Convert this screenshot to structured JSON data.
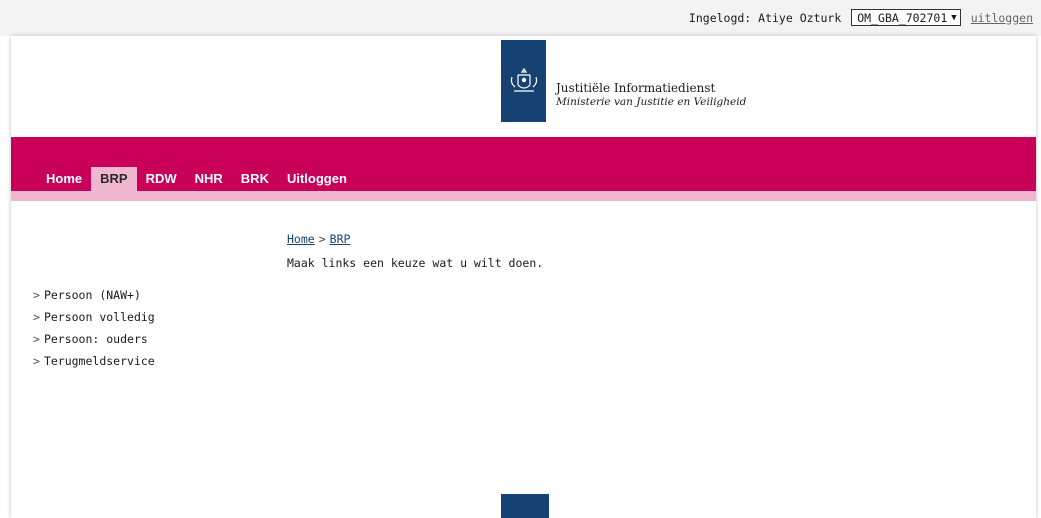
{
  "user_bar": {
    "logged_in_label": "Ingelogd: Atiye Ozturk",
    "organisation_selected": "OM_GBA_702701",
    "logout_link": "uitloggen"
  },
  "header": {
    "org_name": "Justitiële Informatiedienst",
    "ministry": "Ministerie van Justitie en Veiligheid",
    "logo_color": "#154273"
  },
  "nav": {
    "tabs": [
      {
        "label": "Home"
      },
      {
        "label": "BRP",
        "active": true
      },
      {
        "label": "RDW"
      },
      {
        "label": "NHR"
      },
      {
        "label": "BRK"
      },
      {
        "label": "Uitloggen"
      }
    ],
    "accent": "#c8005a",
    "sub_accent": "#f0b5cf"
  },
  "breadcrumb": {
    "items": [
      "Home",
      "BRP"
    ],
    "separator": ">"
  },
  "main": {
    "intro": "Maak links een keuze wat u wilt doen."
  },
  "sidebar": {
    "arrow": ">",
    "items": [
      {
        "label": "Persoon (NAW+)"
      },
      {
        "label": "Persoon volledig"
      },
      {
        "label": "Persoon: ouders"
      },
      {
        "label": "Terugmeldservice"
      }
    ]
  }
}
